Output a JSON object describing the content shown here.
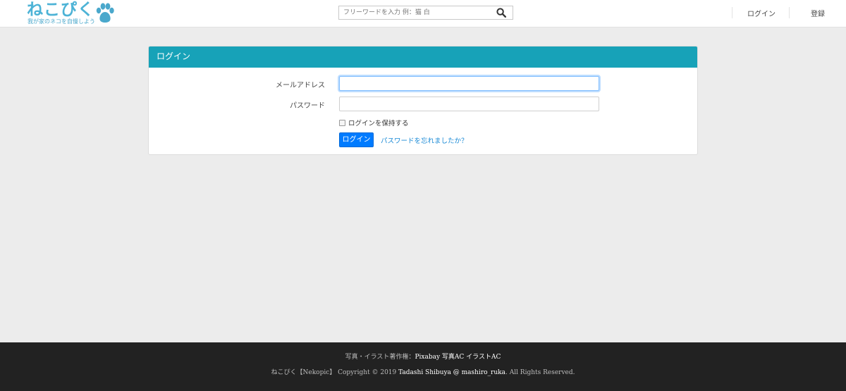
{
  "header": {
    "logo_text": "ねこぴく",
    "logo_tagline": "我が家のネコを自慢しよう",
    "logo_icon": "paw-icon",
    "search_placeholder": "フリーワードを入力 例：猫 白",
    "search_icon": "search-icon",
    "nav": {
      "login": "ログイン",
      "register": "登録"
    }
  },
  "login_card": {
    "title": "ログイン",
    "email_label": "メールアドレス",
    "email_value": "",
    "password_label": "パスワード",
    "password_value": "",
    "remember_label": "ログインを保持する",
    "remember_checked": false,
    "submit_label": "ログイン",
    "forgot_label": "パスワードを忘れましたか？"
  },
  "footer": {
    "credits_prefix": "写真・イラスト著作権：",
    "credits_links": [
      "Pixabay",
      "写真AC",
      "イラストAC"
    ],
    "copyright_prefix": "ねこぴく【Nekopic】 Copyright © 2019 ",
    "author_link": "Tadashi Shibuya @ mashiro_ruka",
    "copyright_suffix": ". All Rights Reserved."
  },
  "colors": {
    "brand": "#4db3d6",
    "card_header": "#17a2b8",
    "primary_button": "#007bff",
    "link": "#1a8ad6",
    "footer_bg": "#222222",
    "page_bg": "#ececec"
  }
}
